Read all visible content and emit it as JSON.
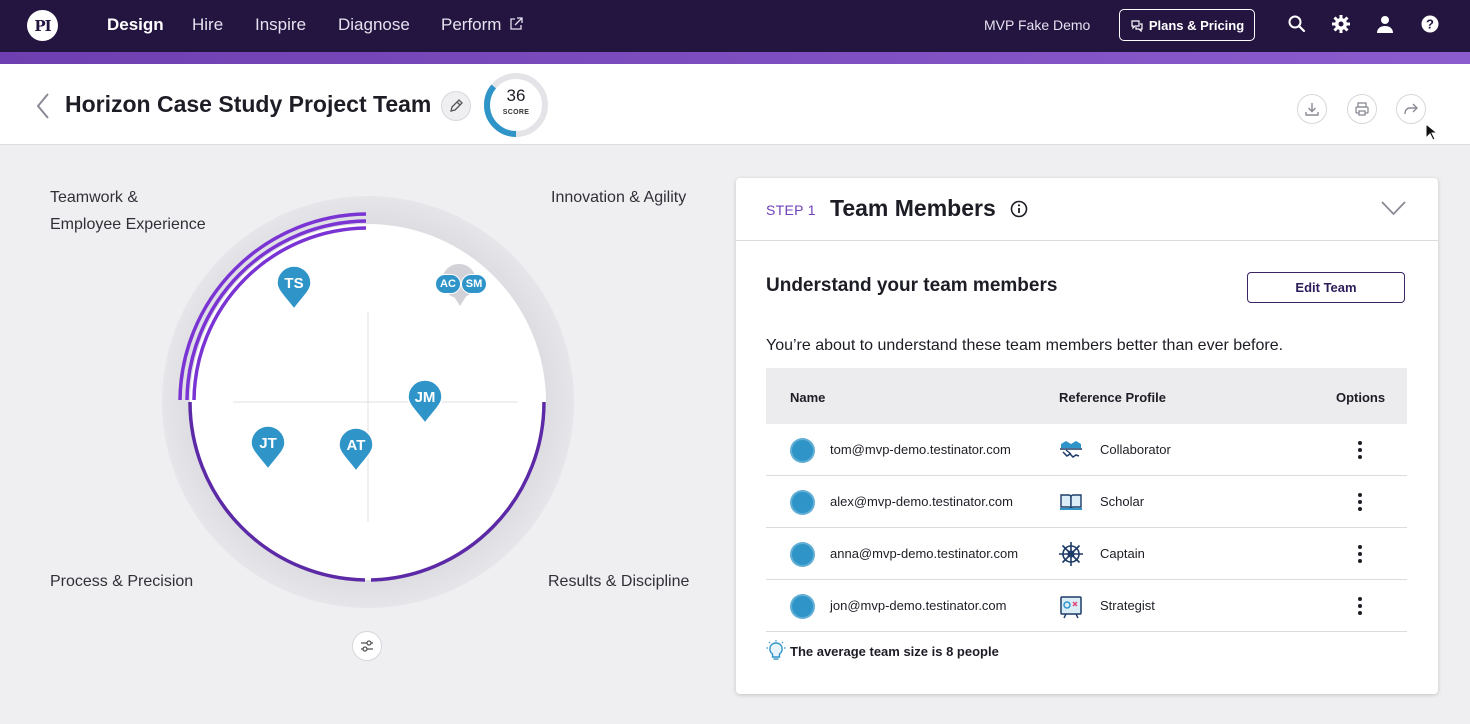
{
  "nav": {
    "logo": "PI",
    "items": [
      "Design",
      "Hire",
      "Inspire",
      "Diagnose",
      "Perform"
    ],
    "active": "Design",
    "account": "MVP Fake Demo",
    "plans_button": "Plans & Pricing",
    "icons": [
      "search-icon",
      "gear-icon",
      "user-icon",
      "help-icon"
    ]
  },
  "header": {
    "title": "Horizon Case Study Project Team",
    "score_value": "36",
    "score_label": "SCORE",
    "score_fraction": 0.36,
    "actions": [
      "download-icon",
      "print-icon",
      "share-icon"
    ]
  },
  "chart": {
    "quadrants": {
      "top_left_line1": "Teamwork &",
      "top_left_line2": "Employee Experience",
      "top_right": "Innovation & Agility",
      "bottom_left": "Process & Precision",
      "bottom_right": "Results & Discipline"
    },
    "pins": [
      "TS",
      "JM",
      "JT",
      "AT"
    ],
    "cluster": [
      "AC",
      "SM"
    ]
  },
  "card": {
    "step_label": "STEP 1",
    "title": "Team Members",
    "subtitle": "Understand your team members",
    "edit_button": "Edit Team",
    "description": "You’re about to understand these team members better than ever before.",
    "columns": {
      "name": "Name",
      "profile": "Reference Profile",
      "options": "Options"
    },
    "rows": [
      {
        "email": "tom@mvp-demo.testinator.com",
        "profile": "Collaborator",
        "icon": "handshake-icon"
      },
      {
        "email": "alex@mvp-demo.testinator.com",
        "profile": "Scholar",
        "icon": "book-icon"
      },
      {
        "email": "anna@mvp-demo.testinator.com",
        "profile": "Captain",
        "icon": "ship-wheel-icon"
      },
      {
        "email": "jon@mvp-demo.testinator.com",
        "profile": "Strategist",
        "icon": "strategy-board-icon"
      }
    ],
    "tip": "The average team size is 8 people"
  },
  "colors": {
    "nav_bg": "#231440",
    "accent_purple": "#7040b8",
    "pin_blue": "#2f95c8"
  }
}
